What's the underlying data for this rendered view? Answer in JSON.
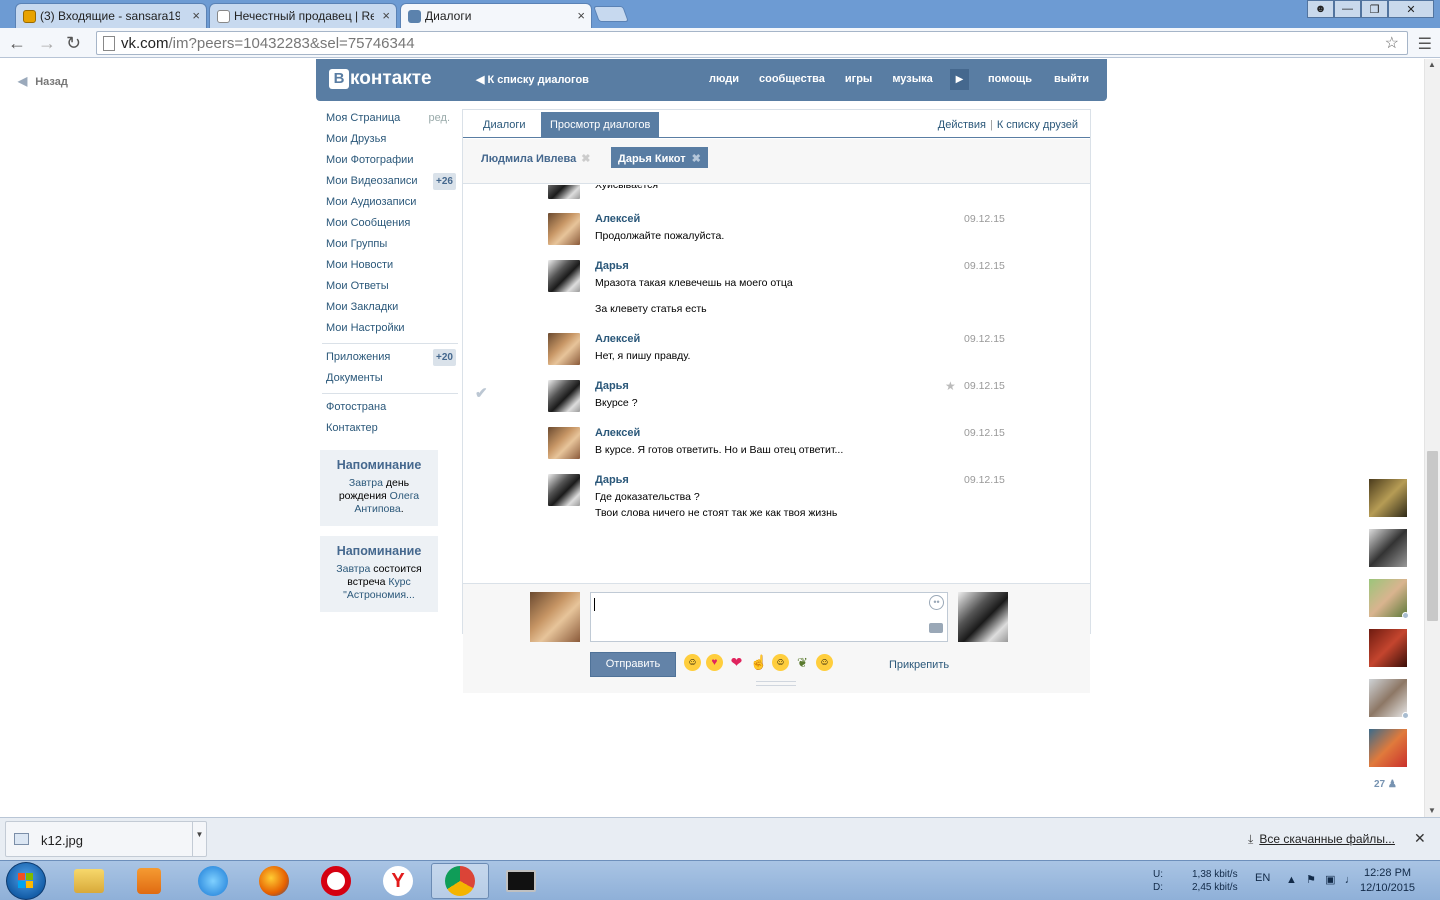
{
  "browser": {
    "tabs": [
      {
        "title": "(3) Входящие - sansara19",
        "active": false
      },
      {
        "title": "Нечестный продавец | Re",
        "active": false
      },
      {
        "title": "Диалоги",
        "active": true
      }
    ],
    "url_host": "vk.com",
    "url_path": "/im?peers=10432283&sel=75746344"
  },
  "page": {
    "back_label": "Назад",
    "logo_text": "контакте",
    "logo_letter": "B",
    "header_back": "К списку диалогов",
    "header_nav": [
      "люди",
      "сообщества",
      "игры",
      "музыка"
    ],
    "header_right": [
      "помощь",
      "выйти"
    ]
  },
  "sidebar": {
    "items": [
      {
        "label": "Моя Страница",
        "extra": "ред."
      },
      {
        "label": "Мои Друзья"
      },
      {
        "label": "Мои Фотографии"
      },
      {
        "label": "Мои Видеозаписи",
        "badge": "+26"
      },
      {
        "label": "Мои Аудиозаписи"
      },
      {
        "label": "Мои Сообщения"
      },
      {
        "label": "Мои Группы"
      },
      {
        "label": "Мои Новости"
      },
      {
        "label": "Мои Ответы"
      },
      {
        "label": "Мои Закладки"
      },
      {
        "label": "Мои Настройки"
      }
    ],
    "apps": [
      {
        "label": "Приложения",
        "badge": "+20"
      },
      {
        "label": "Документы"
      }
    ],
    "links": [
      {
        "label": "Фотострана"
      },
      {
        "label": "Контактер"
      }
    ],
    "reminders": [
      {
        "title": "Напоминание",
        "pre": "Завтра",
        "mid": " день рождения ",
        "link": "Олега Антипова",
        "post": "."
      },
      {
        "title": "Напоминание",
        "pre": "Завтра",
        "mid": " состоится встреча ",
        "link": "Курс \"Астрономия...",
        "post": ""
      }
    ]
  },
  "dialogs": {
    "tab_dialogs": "Диалоги",
    "tab_view": "Просмотр диалогов",
    "actions": "Действия",
    "to_friends": "К списку друзей",
    "people": [
      {
        "name": "Людмила Ивлева",
        "selected": false
      },
      {
        "name": "Дарья Кикот",
        "selected": true
      }
    ]
  },
  "messages": [
    {
      "author": "",
      "avatar": "girl",
      "time": "",
      "lines": [
        "Хуисывается"
      ],
      "partial": true
    },
    {
      "author": "Алексей",
      "avatar": "man",
      "time": "09.12.15",
      "lines": [
        "Продолжайте пожалуйста."
      ]
    },
    {
      "author": "Дарья",
      "avatar": "girl",
      "time": "09.12.15",
      "lines": [
        "Мразота такая клевечешь на моего отца",
        "",
        "За клевету статья есть"
      ]
    },
    {
      "author": "Алексей",
      "avatar": "man",
      "time": "09.12.15",
      "lines": [
        "Нет, я пишу правду."
      ]
    },
    {
      "author": "Дарья",
      "avatar": "girl",
      "time": "09.12.15",
      "lines": [
        "Вкурсе ?"
      ],
      "starred": true,
      "checked": true
    },
    {
      "author": "Алексей",
      "avatar": "man",
      "time": "09.12.15",
      "lines": [
        "В курсе. Я готов ответить. Но и Ваш отец ответит..."
      ]
    },
    {
      "author": "Дарья",
      "avatar": "girl",
      "time": "09.12.15",
      "lines": [
        "Где доказательства ?",
        "Твои слова ничего не стоят так же как твоя жизнь"
      ]
    }
  ],
  "composer": {
    "value": "",
    "send_label": "Отправить",
    "attach_label": "Прикрепить"
  },
  "friends_online": {
    "count": "27"
  },
  "downloads": {
    "file": "k12.jpg",
    "all_label": "Все скачанные файлы..."
  },
  "taskbar": {
    "net_labels": [
      "U:",
      "D:"
    ],
    "net_values": [
      "1,38 kbit/s",
      "2,45 kbit/s"
    ],
    "lang": "EN",
    "time": "12:28 PM",
    "date": "12/10/2015"
  },
  "colors": {
    "vk_header": "#597da3",
    "link": "#2b587a",
    "taskbar": "#a9c4e4"
  }
}
